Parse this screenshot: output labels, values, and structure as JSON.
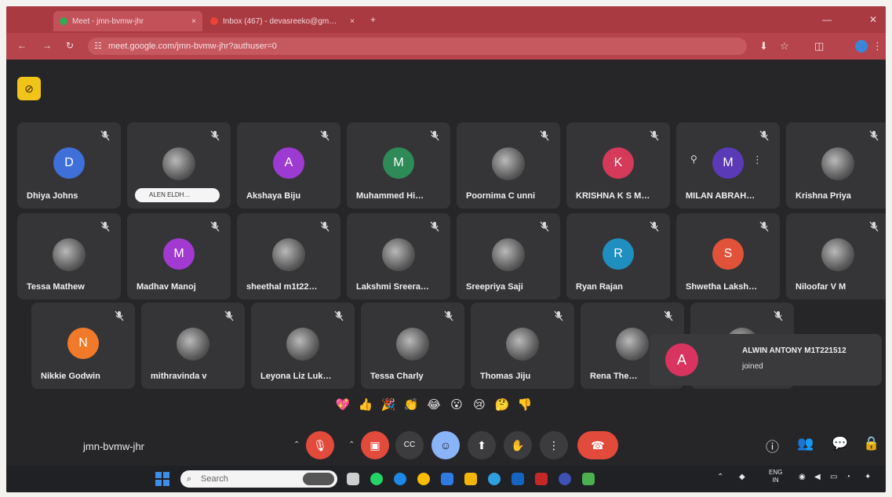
{
  "browser": {
    "tabs": [
      {
        "title": "Meet - jmn-bvmw-jhr",
        "active": true,
        "favicon_color": "#34a853"
      },
      {
        "title": "Inbox (467) - devasreeko@gm…",
        "active": false,
        "favicon_color": "#ea4335"
      }
    ],
    "new_tab_label": "+",
    "close_label": "×",
    "url": "meet.google.com/jmn-bvmw-jhr?authuser=0"
  },
  "meeting": {
    "code": "jmn-bvmw-jhr",
    "participants": [
      {
        "name": "Dhiya Johns",
        "initial": "D",
        "color": "#3f6fd9",
        "photo": false
      },
      {
        "name": "ALEN ELDH…",
        "initial": "",
        "color": "",
        "photo": true,
        "pill": true
      },
      {
        "name": "Akshaya Biju",
        "initial": "A",
        "color": "#9c3ad1",
        "photo": false
      },
      {
        "name": "Muhammed Hi…",
        "initial": "M",
        "color": "#2e8b57",
        "photo": false
      },
      {
        "name": "Poornima C unni",
        "initial": "",
        "color": "",
        "photo": true
      },
      {
        "name": "KRISHNA K S M…",
        "initial": "K",
        "color": "#d63a5a",
        "photo": false
      },
      {
        "name": "MILAN ABRAH…",
        "initial": "M",
        "color": "#5b3ab8",
        "photo": false,
        "pinnable": true
      },
      {
        "name": "Krishna Priya",
        "initial": "",
        "color": "",
        "photo": true
      },
      {
        "name": "Tessa Mathew",
        "initial": "",
        "color": "",
        "photo": true
      },
      {
        "name": "Madhav Manoj",
        "initial": "M",
        "color": "#a23ad1",
        "photo": false
      },
      {
        "name": "sheethal m1t22…",
        "initial": "",
        "color": "",
        "photo": true
      },
      {
        "name": "Lakshmi Sreera…",
        "initial": "",
        "color": "",
        "photo": true
      },
      {
        "name": "Sreepriya Saji",
        "initial": "",
        "color": "",
        "photo": true
      },
      {
        "name": "Ryan Rajan",
        "initial": "R",
        "color": "#1f8fbf",
        "photo": false
      },
      {
        "name": "Shwetha Laksh…",
        "initial": "S",
        "color": "#e0533a",
        "photo": false
      },
      {
        "name": "Niloofar V M",
        "initial": "",
        "color": "",
        "photo": true
      },
      {
        "name": "Nikkie Godwin",
        "initial": "N",
        "color": "#f07a2a",
        "photo": false
      },
      {
        "name": "mithravinda v",
        "initial": "",
        "color": "",
        "photo": true
      },
      {
        "name": "Leyona Liz Luk…",
        "initial": "",
        "color": "",
        "photo": true
      },
      {
        "name": "Tessa Charly",
        "initial": "",
        "color": "",
        "photo": true
      },
      {
        "name": "Thomas Jiju",
        "initial": "",
        "color": "",
        "photo": true
      },
      {
        "name": "Rena The…",
        "initial": "",
        "color": "",
        "photo": true
      },
      {
        "name": "",
        "initial": "",
        "color": "",
        "photo": true
      }
    ],
    "toast": {
      "initial": "A",
      "name": "ALWIN ANTONY M1T221512",
      "status": "joined"
    },
    "reactions": [
      "💖",
      "👍",
      "🎉",
      "👏",
      "😂",
      "😮",
      "😢",
      "🤔",
      "👎"
    ]
  },
  "taskbar": {
    "search_placeholder": "Search",
    "lang_top": "ENG",
    "lang_bottom": "IN"
  },
  "icons": {
    "mic": "🎙",
    "camera": "▣",
    "captions": "CC",
    "emoji": "☺",
    "present": "⬆",
    "hand": "✋",
    "more": "⋮",
    "hangup": "☎",
    "info": "ⓘ",
    "people": "👥",
    "chat": "💬",
    "lock": "🔒"
  }
}
